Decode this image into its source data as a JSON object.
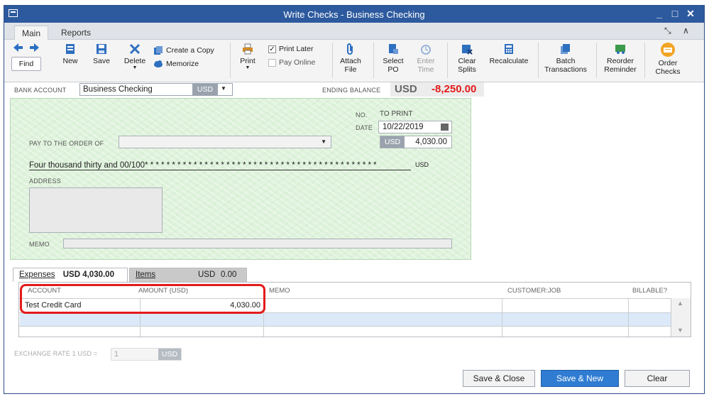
{
  "window": {
    "title": "Write Checks - Business Checking",
    "controls": [
      "_",
      "□",
      "✕"
    ]
  },
  "ribbon_tabs": [
    {
      "label": "Main"
    },
    {
      "label": "Reports"
    }
  ],
  "ribbon_right": {
    "expand": "⤡",
    "collapse": "∧"
  },
  "toolbar": {
    "find": "Find",
    "new": "New",
    "save": "Save",
    "delete": "Delete",
    "create_copy": "Create a Copy",
    "memorize": "Memorize",
    "print": "Print",
    "print_later": "Print Later",
    "pay_online": "Pay Online",
    "attach_file": [
      "Attach",
      "File"
    ],
    "select_po": [
      "Select",
      "PO"
    ],
    "enter_time": [
      "Enter",
      "Time"
    ],
    "clear_splits": [
      "Clear",
      "Splits"
    ],
    "recalculate": "Recalculate",
    "batch_transactions": [
      "Batch",
      "Transactions"
    ],
    "reorder_reminder": [
      "Reorder",
      "Reminder"
    ],
    "order_checks": [
      "Order",
      "Checks"
    ]
  },
  "bank_account": {
    "label": "BANK ACCOUNT",
    "value": "Business Checking",
    "currency": "USD"
  },
  "ending_balance": {
    "label": "ENDING BALANCE",
    "currency": "USD",
    "value": "-8,250.00"
  },
  "check": {
    "no_label": "NO.",
    "no_value": "TO PRINT",
    "date_label": "DATE",
    "date_value": "10/22/2019",
    "pay_to_label": "PAY TO THE ORDER OF",
    "pay_to_value": "",
    "amount_currency": "USD",
    "amount_value": "4,030.00",
    "written_amount": "Four thousand thirty and 00/100* * * * * * * * * * * * * * * * * * * * * * * * * * * * * * * * * * * * * * * * * * *",
    "written_currency": "USD",
    "address_label": "ADDRESS",
    "memo_label": "MEMO"
  },
  "split_tabs": [
    {
      "label": "Expenses",
      "currency": "USD",
      "amount": "4,030.00"
    },
    {
      "label": "Items",
      "currency": "USD",
      "amount": "0.00"
    }
  ],
  "expenses_table": {
    "columns": [
      "ACCOUNT",
      "AMOUNT (USD)",
      "MEMO",
      "CUSTOMER:JOB",
      "BILLABLE?"
    ],
    "rows": [
      {
        "account": "Test Credit Card",
        "amount": "4,030.00",
        "memo": "",
        "customer_job": "",
        "billable": ""
      }
    ]
  },
  "exchange_rate": {
    "label": "EXCHANGE RATE 1 USD =",
    "value": "1",
    "currency": "USD"
  },
  "buttons": {
    "save_close": "Save & Close",
    "save_new": "Save & New",
    "clear": "Clear"
  },
  "colors": {
    "titlebar": "#2d5a9e",
    "check_bg": "#dff3dc",
    "negative": "#e31b1b",
    "highlight": "#e31b1b",
    "primary_button": "#2f7cd2"
  }
}
